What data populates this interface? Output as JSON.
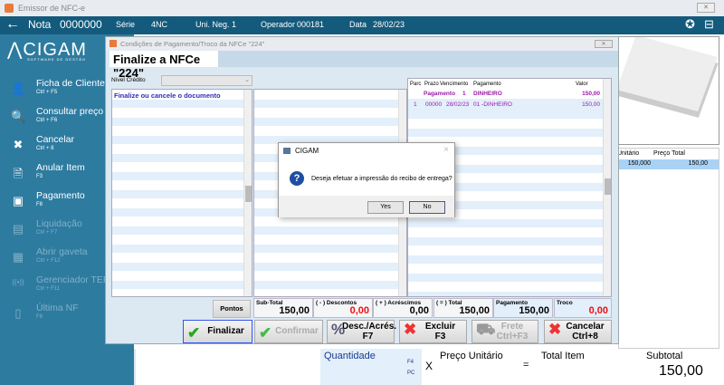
{
  "window": {
    "title": "Emissor de NFC-e"
  },
  "header": {
    "nota_label": "Nota",
    "nota_value": "000000000",
    "serie_label": "Série",
    "serie_value": "4NC",
    "uni_label": "Uni. Neg.",
    "uni_value": "1",
    "operador_label": "Operador",
    "operador_value": "000181",
    "data_label": "Data",
    "data_value": "28/02/23"
  },
  "sidebar": {
    "logo": "CIGAM",
    "logo_sub": "SOFTWARE DE GESTÃO",
    "items": [
      {
        "label": "Ficha de Clientes",
        "shortcut": "Ctrl + F5",
        "icon": "user-icon",
        "enabled": true
      },
      {
        "label": "Consultar preço",
        "shortcut": "Ctrl + F6",
        "icon": "price-search-icon",
        "enabled": true
      },
      {
        "label": "Cancelar",
        "shortcut": "Ctrl + 8",
        "icon": "close-icon",
        "enabled": true
      },
      {
        "label": "Anular Item",
        "shortcut": "F3",
        "icon": "remove-item-icon",
        "enabled": true
      },
      {
        "label": "Pagamento",
        "shortcut": "F8",
        "icon": "money-icon",
        "enabled": true
      },
      {
        "label": "Liquidação",
        "shortcut": "Ctrl + F7",
        "icon": "liquidation-icon",
        "enabled": false
      },
      {
        "label": "Abrir gaveta",
        "shortcut": "Ctrl + F12",
        "icon": "drawer-icon",
        "enabled": false
      },
      {
        "label": "Gerenciador TEF",
        "shortcut": "Ctrl + F11",
        "icon": "wireless-icon",
        "enabled": false
      },
      {
        "label": "Última NF",
        "shortcut": "F8",
        "icon": "receipt-icon",
        "enabled": false
      }
    ]
  },
  "items_grid": {
    "col_unit": "Unitário",
    "col_total": "Preço Total",
    "unit": "150,000",
    "total": "150,00"
  },
  "bottom": {
    "quantidade": "Quantidade",
    "f4": "F4",
    "pc": "PC",
    "x": "X",
    "preco": "Preço Unitário",
    "eq": "=",
    "total_item": "Total Item",
    "subtotal_label": "Subtotal",
    "subtotal": "150,00"
  },
  "dialog": {
    "title": "Condições de Pagamento/Troco da NFCe \"224\"",
    "tab": "Finalize a NFCe \"224\"",
    "nivel_label": "Nível Crédito",
    "message": "Finalize ou cancele o documento",
    "grid": {
      "headers": [
        "Parc",
        "Prazo",
        "Vencimento",
        "Pagamento",
        "Valor"
      ],
      "group": {
        "label": "Pagamento",
        "num": "1",
        "name": "DINHEIRO",
        "valor": "150,00"
      },
      "rows": [
        {
          "parc": "1",
          "prazo": "00000",
          "venc": "28/02/23",
          "pag": "01 -DINHEIRO",
          "valor": "150,00"
        }
      ]
    },
    "pontos": "Pontos",
    "totals": {
      "subtotal_label": "Sub-Total",
      "subtotal": "150,00",
      "desc_label": "( - ) Descontos",
      "desc": "0,00",
      "acr_label": "( + ) Acréscimos",
      "acr": "0,00",
      "total_label": "( = ) Total",
      "total": "150,00",
      "pag_label": "Pagamento",
      "pag": "150,00",
      "troco_label": "Troco",
      "troco": "0,00"
    },
    "buttons": {
      "finalizar": "Finalizar",
      "confirmar": "Confirmar",
      "desc1": "Desc./Acrés.",
      "desc2": "F7",
      "excluir1": "Excluir",
      "excluir2": "F3",
      "frete1": "Frete",
      "frete2": "Ctrl+F3",
      "cancelar1": "Cancelar",
      "cancelar2": "Ctrl+8"
    }
  },
  "msgbox": {
    "title": "CIGAM",
    "text": "Deseja efetuar a impressão do recibo de entrega?",
    "yes": "Yes",
    "no": "No"
  },
  "colors": {
    "header": "#135a7c",
    "sidebar": "#2e7ba0",
    "purple": "#9a1aa8",
    "red": "#ee1111"
  }
}
